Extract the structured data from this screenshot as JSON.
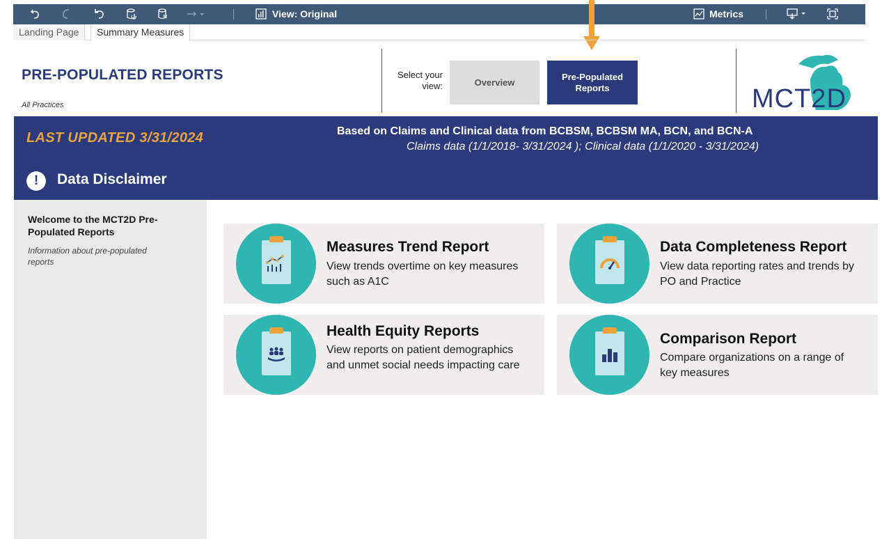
{
  "toolbar": {
    "view_label": "View: Original",
    "metrics_label": "Metrics"
  },
  "tabs": [
    {
      "label": "Landing Page"
    },
    {
      "label": "Summary Measures"
    }
  ],
  "header": {
    "title": "PRE-POPULATED REPORTS",
    "subtitle": "All Practices",
    "select_label": "Select your view:",
    "view_overview": "Overview",
    "view_prepopulated": "Pre-Populated Reports",
    "logo_text": "MCT2D"
  },
  "banner": {
    "last_updated": "LAST UPDATED 3/31/2024",
    "claims_title": "Based on Claims and Clinical data from BCBSM, BCBSM MA, BCN, and BCN-A",
    "claims_sub": "Claims data  (1/1/2018- 3/31/2024 ); Clinical data (1/1/2020 - 3/31/2024)",
    "disclaimer": "Data Disclaimer"
  },
  "sidebar": {
    "title": "Welcome to the MCT2D Pre-Populated Reports",
    "description": "Information about pre-populated reports"
  },
  "reports": [
    {
      "title": "Measures Trend Report",
      "description": "View trends overtime on key measures such as A1C",
      "icon": "trend-chart-icon"
    },
    {
      "title": "Data Completeness Report",
      "description": "View data reporting rates and trends by PO and Practice",
      "icon": "gauge-icon"
    },
    {
      "title": "Health Equity Reports",
      "description": "View reports on patient demographics and unmet social needs impacting care",
      "icon": "people-hand-icon"
    },
    {
      "title": "Comparison Report",
      "description": "Compare organizations on a range of key measures",
      "icon": "bar-comparison-icon"
    }
  ],
  "colors": {
    "navy": "#2b3a7d",
    "toolbar": "#3f5a78",
    "orange": "#e8a33d",
    "teal": "#2db6b2",
    "card_bg": "#efedee",
    "sidebar_bg": "#e9e9e9"
  }
}
